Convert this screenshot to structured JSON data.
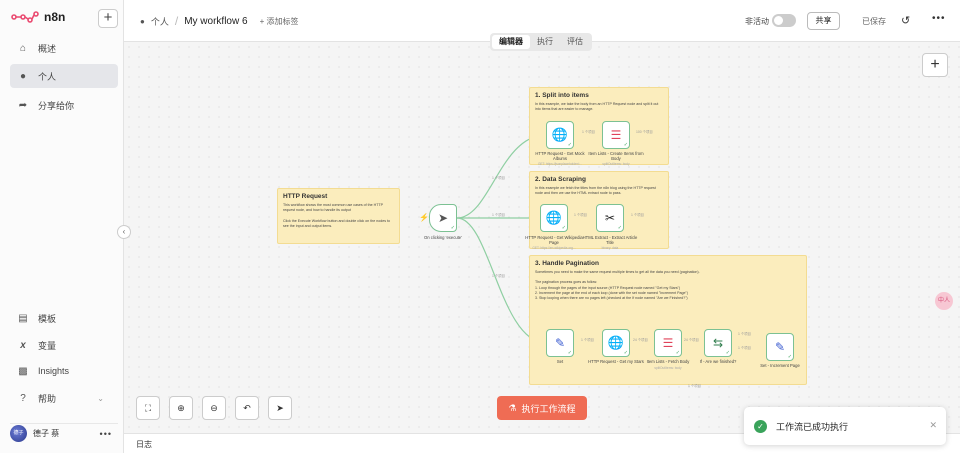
{
  "app": {
    "name": "n8n",
    "brand_color": "#ea4b71",
    "accent_color": "#ef6c54"
  },
  "sidebar": {
    "items": [
      {
        "label": "概述",
        "icon": "home-icon"
      },
      {
        "label": "个人",
        "icon": "user-icon",
        "active": true
      },
      {
        "label": "分享给你",
        "icon": "share-icon"
      }
    ],
    "footer": [
      {
        "label": "模板",
        "icon": "template-icon"
      },
      {
        "label": "变量",
        "icon": "variable-icon"
      },
      {
        "label": "Insights",
        "icon": "chart-icon"
      },
      {
        "label": "帮助",
        "icon": "help-icon"
      }
    ],
    "user": {
      "name": "德子 蔡",
      "avatar_text": "德子"
    }
  },
  "header": {
    "crumb_owner": "个人",
    "workflow_title": "My workflow 6",
    "add_tag": "+ 添加标签",
    "inactive_label": "非活动",
    "share_label": "共享",
    "saved_label": "已保存"
  },
  "tabs": [
    "编辑器",
    "执行",
    "评估"
  ],
  "stickies": {
    "http": {
      "title": "HTTP Request",
      "body": "This workflow shows the most common use cases of the HTTP request node, and how to handle its output\n\nClick the Execute Workflow button and double click on the nodes to see the input and output items."
    },
    "split": {
      "title": "1. Split into items",
      "body": "In this example, we take the body from an HTTP Request node and split it out into items that are easier to manage."
    },
    "scrape": {
      "title": "2. Data Scraping",
      "body": "In this example we fetch the titles from the n8n blog using the HTTP request node and then we use the HTML extract node to pass."
    },
    "paginate": {
      "title": "3. Handle Pagination",
      "body": "Sometimes you need to make the same request multiple times to get all the data you need (pagination).\n\nThe pagination process goes as follow:\n1. Loop through the pages of the input source (HTTP Request node named \"Get my Stars\")\n2. Increment the page at the end of each loop (done with the set node named \"Increment Page\")\n3. Stop looping when there are no pages left (checked at the If node named \"Are we Finished?\")"
    }
  },
  "nodes": {
    "trigger": {
      "label": "On clicking 'execute'"
    },
    "get_albums": {
      "label": "HTTP Request - Get Mock Albums",
      "sub": "GET: https://jsonplaceholder.t..."
    },
    "create_items": {
      "label": "Item Lists - Create Items from Body",
      "sub": "splitOutItems: body"
    },
    "get_wiki": {
      "label": "HTTP Request - Get Wikipedia Page",
      "sub": "GET: https://en.wikipedia.org..."
    },
    "extract_title": {
      "label": "HTML Extract - Extract Article Title",
      "sub": "binary: data"
    },
    "set": {
      "label": "Set"
    },
    "get_stars": {
      "label": "HTTP Request - Get my Stars"
    },
    "fetch_body": {
      "label": "Item Lists - Fetch Body",
      "sub": "splitOutItems: body"
    },
    "finished": {
      "label": "If - Are we finished?"
    },
    "increment": {
      "label": "Set - Increment Page"
    }
  },
  "edges": {
    "one_item": "1 个项目",
    "items_100": "100 个项目",
    "items_24": "24 个项目"
  },
  "execute_button": "执行工作流程",
  "toast": {
    "message": "工作流已成功执行"
  },
  "log": {
    "label": "日志"
  }
}
